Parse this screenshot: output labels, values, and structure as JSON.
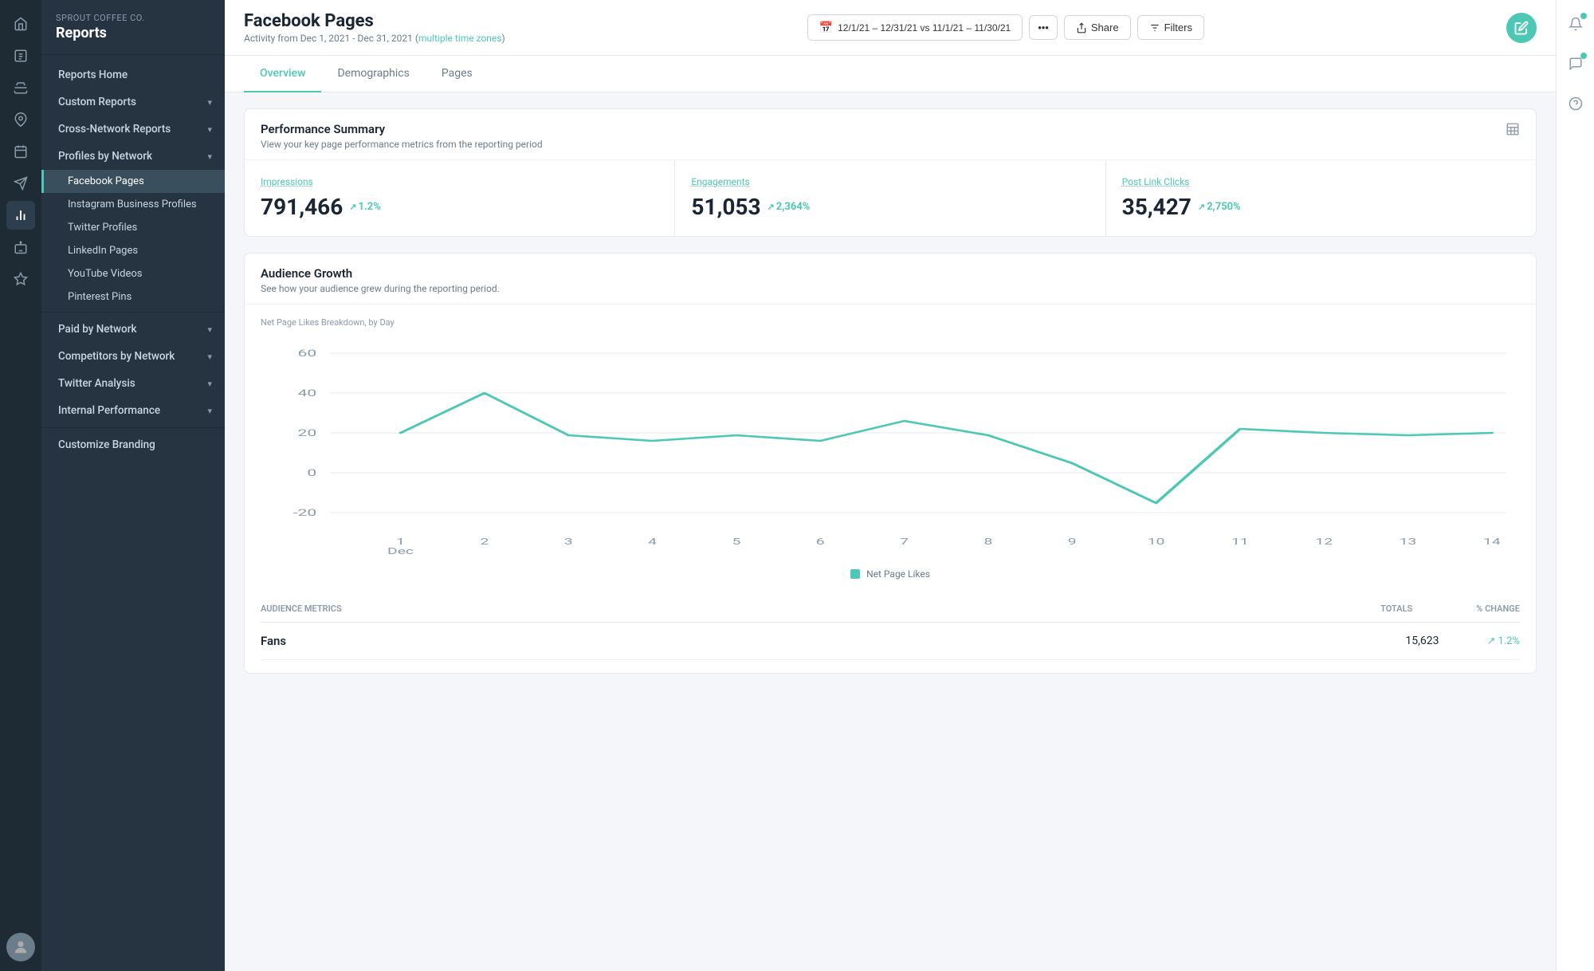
{
  "company": "Sprout Coffee Co.",
  "app_title": "Reports",
  "page": {
    "title": "Facebook Pages",
    "subtitle": "Activity from Dec 1, 2021 - Dec 31, 2021",
    "timezone_link": "multiple time zones"
  },
  "header": {
    "date_range": "12/1/21 – 12/31/21 vs 11/1/21 – 11/30/21",
    "share_label": "Share",
    "filters_label": "Filters"
  },
  "tabs": [
    {
      "id": "overview",
      "label": "Overview",
      "active": true
    },
    {
      "id": "demographics",
      "label": "Demographics",
      "active": false
    },
    {
      "id": "pages",
      "label": "Pages",
      "active": false
    }
  ],
  "performance_summary": {
    "title": "Performance Summary",
    "subtitle": "View your key page performance metrics from the reporting period",
    "metrics": [
      {
        "label": "Impressions",
        "value": "791,466",
        "change": "1.2%",
        "up": true
      },
      {
        "label": "Engagements",
        "value": "51,053",
        "change": "2,364%",
        "up": true
      },
      {
        "label": "Post Link Clicks",
        "value": "35,427",
        "change": "2,750%",
        "up": true
      }
    ]
  },
  "audience_growth": {
    "title": "Audience Growth",
    "subtitle": "See how your audience grew during the reporting period.",
    "chart_label": "Net Page Likes Breakdown, by Day",
    "y_axis": [
      60,
      40,
      20,
      0,
      -20
    ],
    "x_axis": [
      "1\nDec",
      "2",
      "3",
      "4",
      "5",
      "6",
      "7",
      "8",
      "9",
      "10",
      "11",
      "12",
      "13",
      "14"
    ],
    "legend_label": "Net Page Likes",
    "chart_color": "#4dc8b4"
  },
  "audience_metrics": {
    "header": {
      "label": "Audience Metrics",
      "totals": "Totals",
      "change": "% Change"
    },
    "rows": [
      {
        "label": "Fans",
        "total": "15,623",
        "change": "1.2%",
        "up": true
      }
    ]
  },
  "sidebar": {
    "items": [
      {
        "id": "reports-home",
        "label": "Reports Home",
        "type": "main"
      },
      {
        "id": "custom-reports",
        "label": "Custom Reports",
        "type": "expandable"
      },
      {
        "id": "cross-network",
        "label": "Cross-Network Reports",
        "type": "expandable"
      },
      {
        "id": "profiles-by-network",
        "label": "Profiles by Network",
        "type": "expandable"
      },
      {
        "id": "facebook-pages",
        "label": "Facebook Pages",
        "type": "sub",
        "active": true
      },
      {
        "id": "instagram-business",
        "label": "Instagram Business Profiles",
        "type": "sub"
      },
      {
        "id": "twitter-profiles",
        "label": "Twitter Profiles",
        "type": "sub"
      },
      {
        "id": "linkedin-pages",
        "label": "LinkedIn Pages",
        "type": "sub"
      },
      {
        "id": "youtube-videos",
        "label": "YouTube Videos",
        "type": "sub"
      },
      {
        "id": "pinterest-pins",
        "label": "Pinterest Pins",
        "type": "sub"
      },
      {
        "id": "paid-by-network",
        "label": "Paid by Network",
        "type": "expandable"
      },
      {
        "id": "competitors-by-network",
        "label": "Competitors by Network",
        "type": "expandable"
      },
      {
        "id": "twitter-analysis",
        "label": "Twitter Analysis",
        "type": "expandable"
      },
      {
        "id": "internal-performance",
        "label": "Internal Performance",
        "type": "expandable"
      },
      {
        "id": "customize-branding",
        "label": "Customize Branding",
        "type": "main"
      }
    ]
  }
}
